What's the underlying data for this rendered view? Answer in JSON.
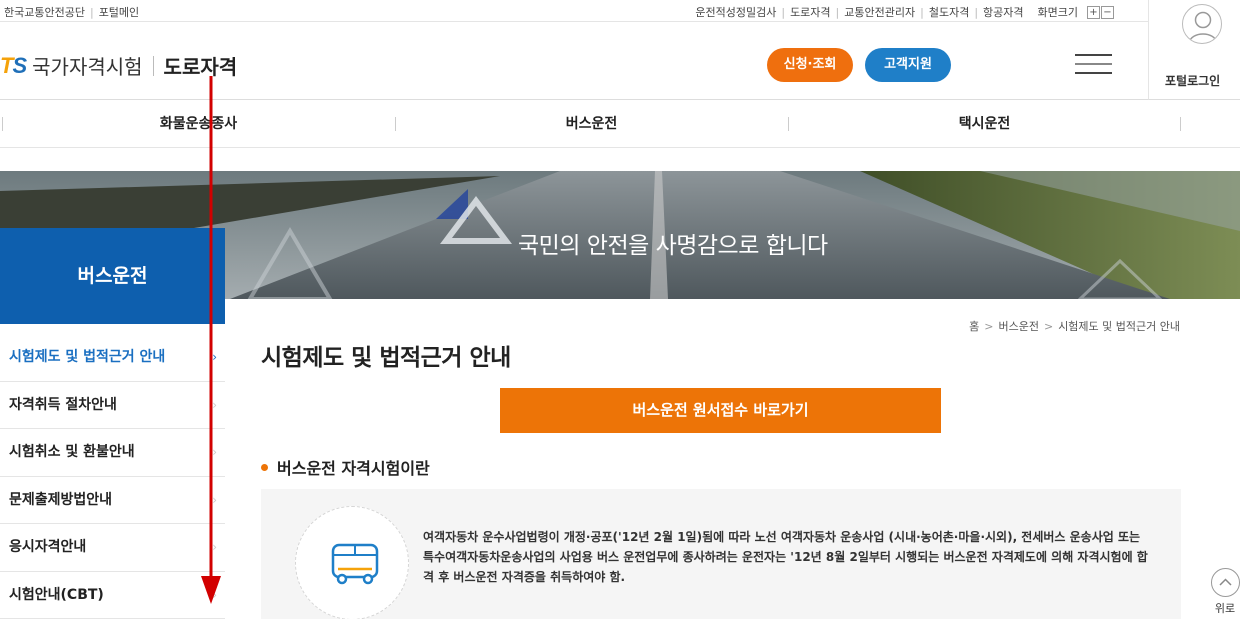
{
  "utility": {
    "left_links": [
      "한국교통안전공단",
      "포털메인"
    ],
    "right_links": [
      "운전적성정밀검사",
      "도로자격",
      "교통안전관리자",
      "철도자격",
      "항공자격"
    ],
    "zoom_label": "화면크기",
    "zoom_in": "+",
    "zoom_out": "−"
  },
  "header": {
    "logo_mark": "TS",
    "logo_name": "국가자격시험",
    "logo_sub": "도로자격",
    "apply_button": "신청·조회",
    "support_button": "고객지원",
    "login_label": "포털로그인"
  },
  "gnb": {
    "items": [
      "화물운송종사",
      "버스운전",
      "택시운전"
    ]
  },
  "banner": {
    "slogan": "국민의 안전을 사명감으로 합니다"
  },
  "lnb": {
    "title": "버스운전",
    "items": [
      {
        "label": "시험제도 및 법적근거 안내",
        "active": true
      },
      {
        "label": "자격취득 절차안내",
        "active": false
      },
      {
        "label": "시험취소 및 환불안내",
        "active": false
      },
      {
        "label": "문제출제방법안내",
        "active": false
      },
      {
        "label": "응시자격안내",
        "active": false
      },
      {
        "label": "시험안내(CBT)",
        "active": false
      }
    ]
  },
  "content": {
    "breadcrumb": [
      "홈",
      "버스운전",
      "시험제도 및 법적근거 안내"
    ],
    "page_title": "시험제도 및 법적근거 안내",
    "shortcut_button": "버스운전 원서접수 바로가기",
    "section_title": "버스운전 자격시험이란",
    "info_text": "여객자동차 운수사업법령이 개정·공포('12년 2월 1일)됨에 따라 노선 여객자동차 운송사업 (시내·농어촌·마을·시외), 전세버스 운송사업 또는 특수여객자동차운송사업의 사업용 버스 운전업무에 종사하려는 운전자는 '12년 8월 2일부터 시행되는 버스운전 자격제도에 의해 자격시험에 합격 후 버스운전 자격증을 취득하여야 함."
  },
  "top_button": {
    "label": "위로"
  },
  "colors": {
    "brand_blue": "#0e5fae",
    "orange": "#ed7407",
    "support_blue": "#1f7fc8",
    "annotation_red": "#d20000"
  }
}
